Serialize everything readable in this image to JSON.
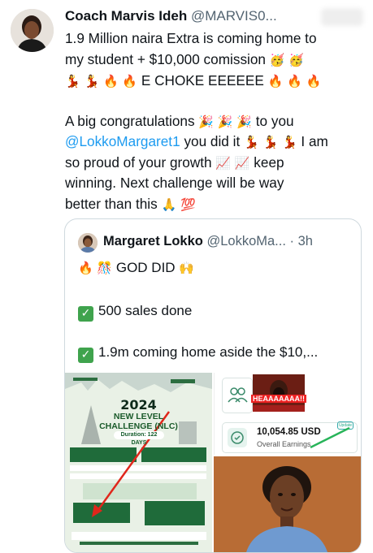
{
  "tweet": {
    "author_name": "Coach Marvis Ideh",
    "author_handle": "@MARVIS0...",
    "text_lines": [
      "1.9 Million naira Extra is coming home to",
      "my student + $10,000 comission"
    ],
    "line3_text": " E CHOKE EEEEEE ",
    "para2_line1_pre": "A big congratulations ",
    "para2_line1_post": " to you",
    "para2_mention": "@LokkoMargaret1",
    "para2_line2_post": " you did it ",
    "para2_line2_tail": " I am",
    "para2_line3_pre": "so proud of your growth ",
    "para2_line3_post": " keep",
    "para2_line4": "winning. Next challenge will be way",
    "para2_line5": "better than this ",
    "emojis": {
      "party_face": "🥳",
      "dancer": "💃",
      "fire": "🔥",
      "party_popper": "🎉",
      "chart_up": "📈",
      "pray": "🙏",
      "hundred": "💯",
      "celebrate": "🎊",
      "raised_hands": "🙌"
    }
  },
  "quote": {
    "author_name": "Margaret Lokko",
    "author_handle": "@LokkoMa...",
    "time": "· 3h",
    "line1_text": "GOD DID ",
    "line2_text": "500 sales done",
    "line3_text": "1.9m coming home aside the $10,...",
    "check_glyph": "✓"
  },
  "media": {
    "flyer_year": "2024",
    "flyer_line1": "NEW LEVEL",
    "flyer_line2": "CHALLENGE (NLC)",
    "flyer_days": "Duration: 122 DAYS",
    "earnings_value": "10,054.85 USD",
    "earnings_label": "Overall Earnings",
    "face_caption": "HEAAAAAAA!!",
    "update_label": "Update"
  }
}
